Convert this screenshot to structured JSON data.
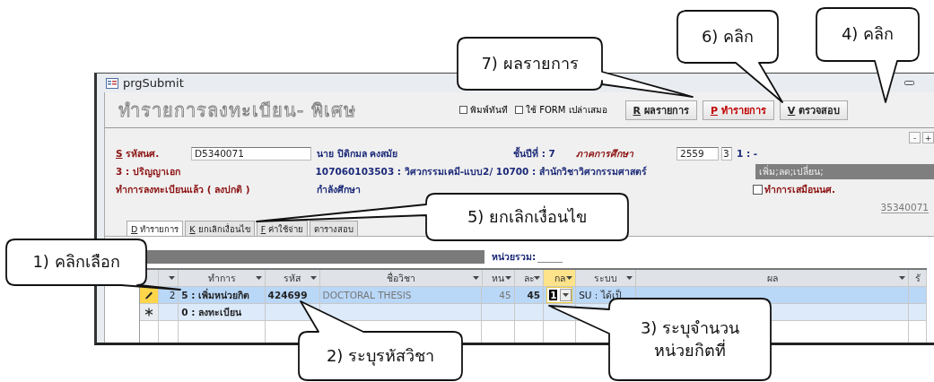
{
  "window": {
    "title": "prgSubmit"
  },
  "form_title": "ทำรายการลงทะเบียน- พิเศษ",
  "options": [
    {
      "label": "พิมพ์ทันที",
      "checked": false
    },
    {
      "label": "ใช้ FORM เปล่าเสมอ",
      "checked": false
    }
  ],
  "buttons": [
    {
      "key": "R",
      "label": "ผลรายการ",
      "highlighted": false
    },
    {
      "key": "P",
      "label": "ทำรายการ",
      "highlighted": true
    },
    {
      "key": "V",
      "label": "ตรวจสอบ",
      "highlighted": false
    }
  ],
  "zoom_buttons": [
    "-",
    "+"
  ],
  "student": {
    "id_key": "S",
    "id_label": "รหัสนศ.",
    "id": "D5340071",
    "name": "นาย ปิดิกมล คงสมัย",
    "year": "ชั้นปีที่ : 7",
    "term_label": "ภาคการศึกษา",
    "term_year": "2559",
    "term": "3",
    "term_note": "1 : -",
    "degree": "3 : ปริญญาเอก",
    "program": "107060103503 : วิศวกรรมเคมี-แบบ2/ 10700 : สำนักวิชาวิศวกรรมศาสตร์",
    "actions": "เพิ่ม;ลด;เปลี่ยน;",
    "reg_status": "ทำการลงทะเบียนแล้ว ( ลงปกติ )",
    "study_status": "กำลังศึกษา",
    "simulate": {
      "label": "ทำการเสมือนนศ.",
      "checked": false
    },
    "code": "35340071"
  },
  "tabs": [
    {
      "key": "D",
      "label": "ทำรายการ",
      "selected": true
    },
    {
      "key": "K",
      "label": "ยกเลิกเงื่อนไข",
      "selected": false
    },
    {
      "key": "F",
      "label": "ค่าใช้จ่าย",
      "selected": false
    },
    {
      "label": "ตารางสอบ",
      "selected": false
    }
  ],
  "total_label": "หน่วยรวม:",
  "table": {
    "columns": [
      {
        "filter": true,
        "selected": false
      },
      {
        "label": "ทำการ",
        "filter": true,
        "selected": false
      },
      {
        "label": "รหัส",
        "filter": true,
        "selected": false
      },
      {
        "label": "ชื่อวิชา",
        "filter": true,
        "selected": false
      },
      {
        "label": "หน",
        "filter": true,
        "selected": false
      },
      {
        "label": "ละ",
        "filter": true,
        "selected": false
      },
      {
        "label": "กล",
        "filter": true,
        "selected": true
      },
      {
        "label": "ระบบ",
        "filter": true,
        "selected": false
      },
      {
        "label": "ผล",
        "filter": true,
        "selected": false
      },
      {
        "label": "รั",
        "filter": false,
        "selected": false
      }
    ],
    "rows": [
      {
        "kind": "editing",
        "selected": true,
        "cells": [
          "2",
          "5 : เพิ่มหน่วยกิต",
          "424699",
          "DOCTORAL THESIS",
          "45",
          "45",
          "1",
          "SU : ได้เป็",
          null,
          null
        ]
      },
      {
        "kind": "new",
        "selected": false,
        "cells": [
          null,
          "0 : ลงทะเบียน",
          null,
          null,
          null,
          null,
          null,
          null,
          null,
          null
        ]
      }
    ]
  },
  "callouts": [
    {
      "text": "6) คลิก"
    },
    {
      "text": "4) คลิก"
    },
    {
      "text": "7) ผลรายการ"
    },
    {
      "text": "5) ยกเลิกเงื่อนไข"
    },
    {
      "text": "1) คลิกเลือก"
    },
    {
      "text": "3) ระบุจำนวน\nหน่วยกิตที่"
    },
    {
      "text": "2) ระบุรหัสวิชา"
    }
  ]
}
